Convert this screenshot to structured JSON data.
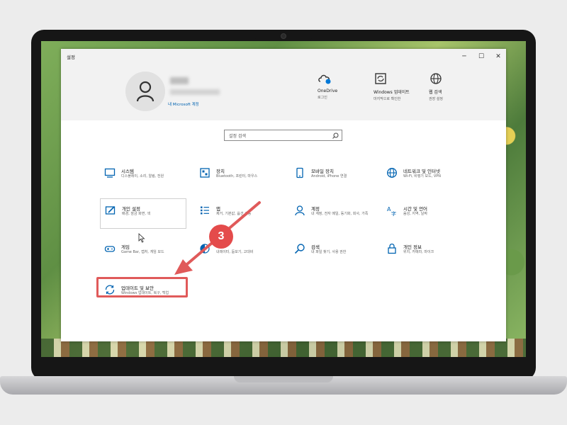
{
  "window": {
    "title": "설정",
    "minimize": "─",
    "maximize": "☐",
    "close": "✕"
  },
  "account": {
    "link": "내 Microsoft 계정"
  },
  "header_items": [
    {
      "name": "OneDrive",
      "sub": "로그인"
    },
    {
      "name": "Windows 업데이트",
      "sub": "마지막으로 확인한"
    },
    {
      "name": "웹 검색",
      "sub": "권장 설정"
    }
  ],
  "search": {
    "placeholder": "설정 검색"
  },
  "categories": [
    {
      "name": "시스템",
      "desc": "디스플레이, 소리, 알림, 전원"
    },
    {
      "name": "장치",
      "desc": "Bluetooth, 프린터, 마우스"
    },
    {
      "name": "모바일 장치",
      "desc": "Android, iPhone 연결"
    },
    {
      "name": "네트워크 및 인터넷",
      "desc": "Wi-Fi, 비행기 모드, VPN"
    },
    {
      "name": "개인 설정",
      "desc": "배경, 잠금 화면, 색"
    },
    {
      "name": "앱",
      "desc": "제거, 기본값, 옵션 기능"
    },
    {
      "name": "계정",
      "desc": "내 계정, 전자 메일, 동기화, 회사, 가족"
    },
    {
      "name": "시간 및 언어",
      "desc": "음성, 지역, 날짜"
    },
    {
      "name": "게임",
      "desc": "Game Bar, 캡처, 게임 모드"
    },
    {
      "name": "접근성",
      "desc": "내레이터, 돋보기, 고대비"
    },
    {
      "name": "검색",
      "desc": "내 파일 찾기, 사용 권한"
    },
    {
      "name": "개인 정보",
      "desc": "위치, 카메라, 마이크"
    },
    {
      "name": "업데이트 및 보안",
      "desc": "Windows 업데이트, 복구, 백업"
    }
  ],
  "annotation": {
    "step": "3"
  },
  "colors": {
    "accent": "#0063b1",
    "highlight": "#e05a5a"
  }
}
